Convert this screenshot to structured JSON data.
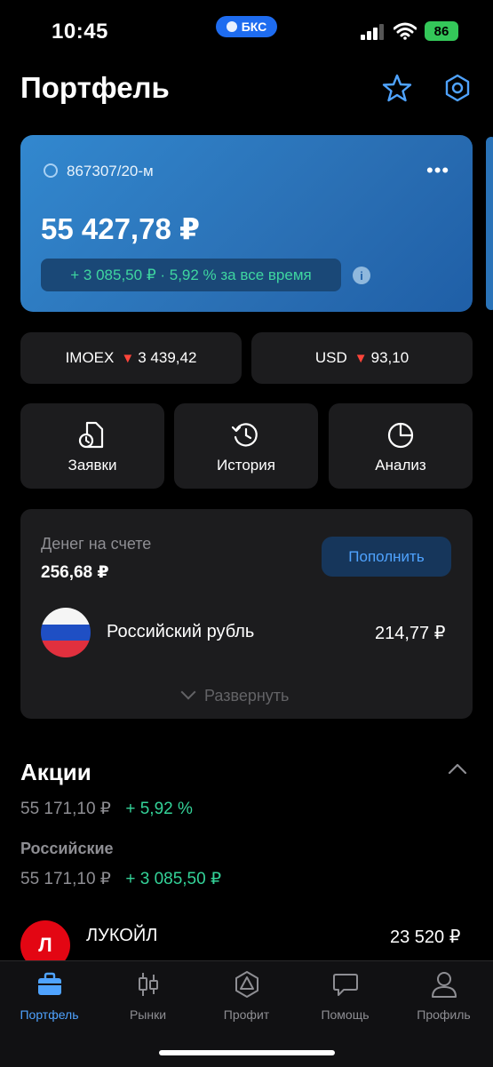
{
  "status_bar": {
    "time": "10:45",
    "carrier_pill": "БКС",
    "battery": "86"
  },
  "header": {
    "title": "Портфель"
  },
  "account": {
    "number": "867307/20-м",
    "balance": "55 427,78 ₽",
    "change": "+ 3 085,50 ₽ · 5,92 % за все время"
  },
  "indices": [
    {
      "name": "IMOEX",
      "value": "3 439,42",
      "direction": "down"
    },
    {
      "name": "USD",
      "value": "93,10",
      "direction": "down"
    }
  ],
  "actions": [
    {
      "label": "Заявки",
      "icon": "orders-icon"
    },
    {
      "label": "История",
      "icon": "history-icon"
    },
    {
      "label": "Анализ",
      "icon": "analysis-pie-icon"
    }
  ],
  "money": {
    "label": "Денег на счете",
    "value": "256,68 ₽",
    "topup_label": "Пополнить",
    "currency_name": "Российский рубль",
    "currency_value": "214,77 ₽",
    "expand_label": "Развернуть"
  },
  "stocks": {
    "title": "Акции",
    "total": "55 171,10 ₽",
    "total_change": "+ 5,92 %",
    "group_title": "Российские",
    "group_total": "55 171,10 ₽",
    "group_change": "+ 3 085,50 ₽",
    "items": [
      {
        "name": "ЛУКОЙЛ",
        "value": "23 520 ₽"
      }
    ]
  },
  "tabs": [
    {
      "label": "Портфель",
      "active": true
    },
    {
      "label": "Рынки",
      "active": false
    },
    {
      "label": "Профит",
      "active": false
    },
    {
      "label": "Помощь",
      "active": false
    },
    {
      "label": "Профиль",
      "active": false
    }
  ],
  "colors": {
    "accent": "#4fa3ff",
    "positive": "#34d399",
    "negative": "#ff453a",
    "card": "#2a6fb4"
  }
}
